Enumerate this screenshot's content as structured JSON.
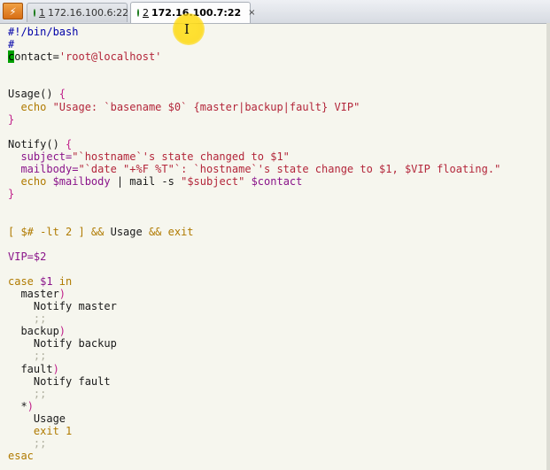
{
  "tabs": [
    {
      "number": "1",
      "label": "172.16.100.6:22",
      "active": false
    },
    {
      "number": "2",
      "label": "172.16.100.7:22",
      "active": true
    }
  ],
  "tab_close_glyph": "×",
  "menu_icon": "lightning-menu-icon",
  "editor": {
    "line_01": "#!/bin/bash",
    "line_02": "#",
    "line_03_cursor": "c",
    "line_03_rest_a": "ontact=",
    "line_03_rest_b": "'root@localhost'",
    "line_06_a": "Usage() ",
    "line_06_b": "{",
    "line_07_a": "  echo ",
    "line_07_b": "\"Usage: `basename $0` {master|backup|fault} VIP\"",
    "line_08": "}",
    "line_10_a": "Notify() ",
    "line_10_b": "{",
    "line_11_a": "  subject=",
    "line_11_b": "\"`hostname`'s state changed to $1\"",
    "line_12_a": "  mailbody=",
    "line_12_b": "\"`date \"+%F %T\"`: `hostname`'s state change to $1, $VIP floating.\"",
    "line_13_a": "  echo ",
    "line_13_b": "$mailbody",
    "line_13_c": " | mail -s ",
    "line_13_d": "\"$subject\"",
    "line_13_e": " $contact",
    "line_14": "}",
    "line_17_a": "[ $# -lt 2 ] && ",
    "line_17_b": "Usage",
    "line_17_c": " && exit",
    "line_19": "VIP=$2",
    "line_21_a": "case ",
    "line_21_b": "$1",
    "line_21_c": " in",
    "line_22_a": "  master",
    "line_22_b": ")",
    "line_23": "    Notify master",
    "line_24": "    ;;",
    "line_25_a": "  backup",
    "line_25_b": ")",
    "line_26": "    Notify backup",
    "line_27": "    ;;",
    "line_28_a": "  fault",
    "line_28_b": ")",
    "line_29": "    Notify fault",
    "line_30": "    ;;",
    "line_31_a": "  *",
    "line_31_b": ")",
    "line_32": "    Usage",
    "line_33": "    exit 1",
    "line_34": "    ;;",
    "line_35": "esac"
  }
}
